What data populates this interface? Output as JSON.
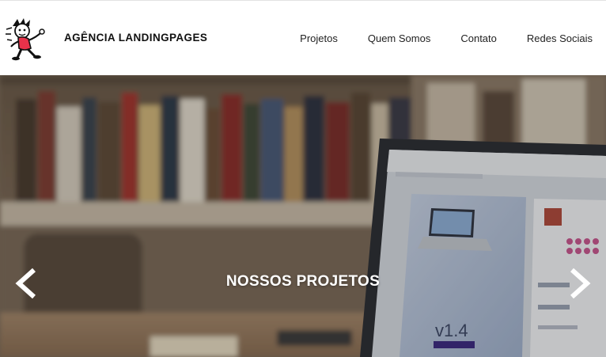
{
  "header": {
    "brand": "AGÊNCIA LANDINGPAGES",
    "nav": [
      {
        "label": "Projetos"
      },
      {
        "label": "Quem Somos"
      },
      {
        "label": "Contato"
      },
      {
        "label": "Redes Sociais"
      }
    ]
  },
  "hero": {
    "title": "NOSSOS PROJETOS",
    "prev_icon": "chevron-left-icon",
    "next_icon": "chevron-right-icon"
  },
  "colors": {
    "header_bg": "#ffffff",
    "hero_text": "#ffffff",
    "brand_text": "#111111"
  }
}
